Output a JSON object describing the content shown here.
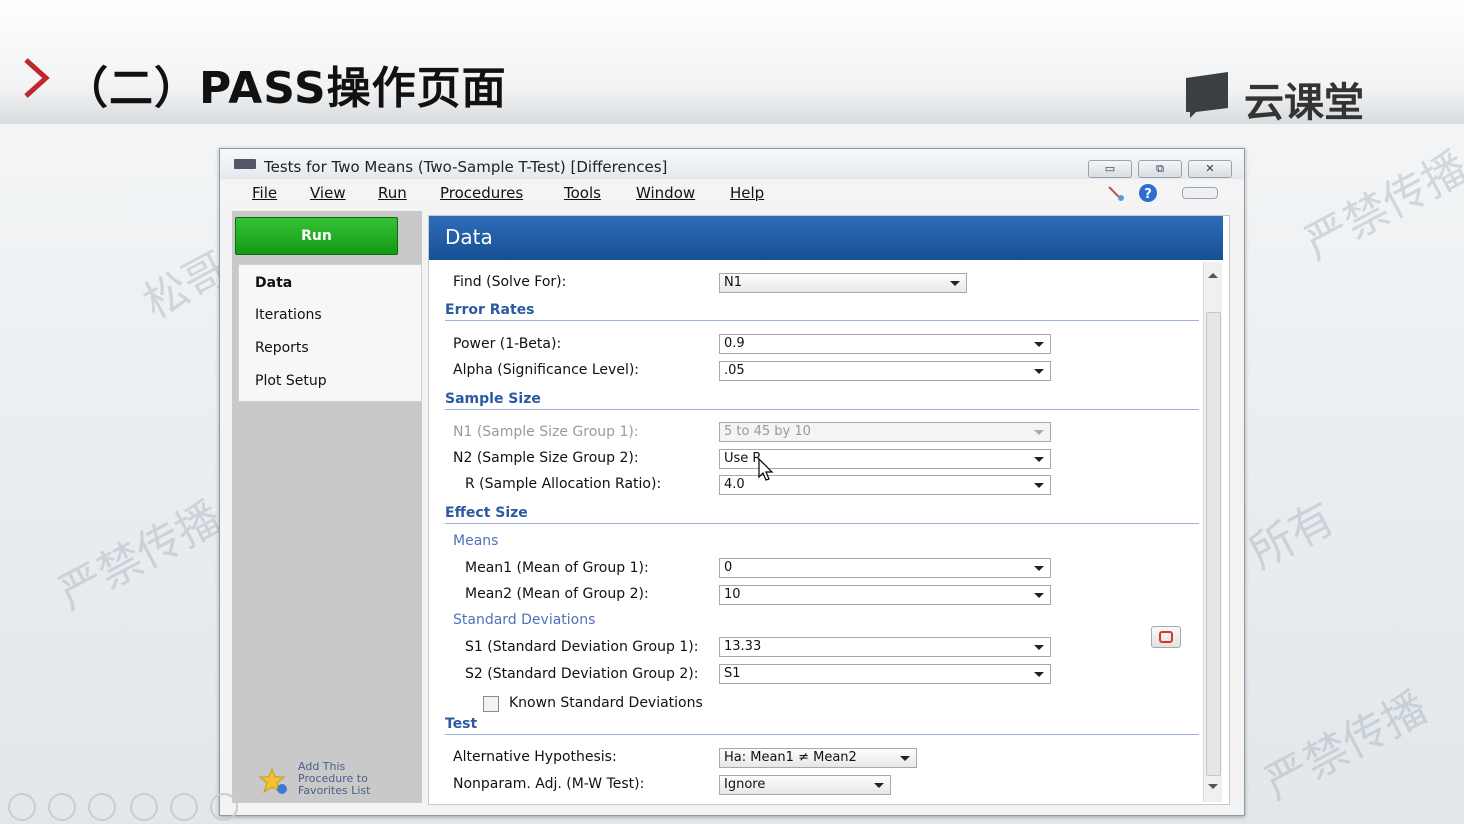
{
  "slide": {
    "title": "（二）PASS操作页面",
    "logo_text": "云课堂",
    "watermarks": [
      "严禁传播",
      "松哥统计版权所有",
      "严禁传播",
      "所有",
      "松哥",
      "严禁传播"
    ]
  },
  "window": {
    "title": "Tests for Two Means (Two-Sample T-Test) [Differences]",
    "buttons": [
      "▭",
      "⧉",
      "✕"
    ]
  },
  "menu": [
    "File",
    "View",
    "Run",
    "Procedures",
    "Tools",
    "Window",
    "Help"
  ],
  "left_panel": {
    "run_label": "Run",
    "nav": [
      "Data",
      "Iterations",
      "Reports",
      "Plot Setup"
    ],
    "favorites_text": [
      "Add This",
      "Procedure to",
      "Favorites List"
    ]
  },
  "content": {
    "header": "Data",
    "find_label": "Find (Solve For):",
    "find_value": "N1",
    "sections": {
      "error_rates": "Error Rates",
      "sample_size": "Sample Size",
      "effect_size": "Effect Size",
      "test": "Test"
    },
    "subsections": {
      "means": "Means",
      "std_devs": "Standard Deviations"
    },
    "fields": {
      "power": {
        "label": "Power (1-Beta):",
        "value": "0.9"
      },
      "alpha": {
        "label": "Alpha (Significance Level):",
        "value": ".05"
      },
      "n1": {
        "label": "N1 (Sample Size Group 1):",
        "value": "5 to 45 by 10"
      },
      "n2": {
        "label": "N2 (Sample Size Group 2):",
        "value": "Use R"
      },
      "r": {
        "label": "R (Sample Allocation Ratio):",
        "value": "4.0"
      },
      "mean1": {
        "label": "Mean1 (Mean of Group 1):",
        "value": "0"
      },
      "mean2": {
        "label": "Mean2 (Mean of Group 2):",
        "value": "10"
      },
      "s1": {
        "label": "S1 (Standard Deviation Group 1):",
        "value": "13.33"
      },
      "s2": {
        "label": "S2 (Standard Deviation Group 2):",
        "value": "S1"
      },
      "known_sd": {
        "label": "Known Standard Deviations",
        "checked": false
      },
      "alt_hyp": {
        "label": "Alternative Hypothesis:",
        "value": "Ha: Mean1 ≠ Mean2"
      },
      "nonparam": {
        "label": "Nonparam. Adj. (M-W Test):",
        "value": "Ignore"
      }
    }
  },
  "colors": {
    "run_green": "#149a14",
    "header_blue": "#174f95",
    "section_blue": "#2c5aa0"
  }
}
